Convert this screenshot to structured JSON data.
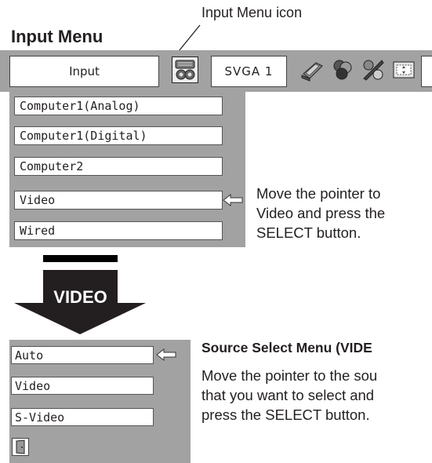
{
  "page_title": "Input Menu",
  "input_menu_icon_caption": "Input Menu icon",
  "menubar": {
    "input_label": "Input",
    "signal_label": "SVGA 1",
    "icons": [
      "input-menu-icon",
      "pc-adjust-icon",
      "color-adjust-icon",
      "image-adjust-icon",
      "screen-icon"
    ]
  },
  "input_menu": {
    "items": [
      "Computer1(Analog)",
      "Computer1(Digital)",
      "Computer2",
      "Video",
      "Wired"
    ],
    "selected": "Video"
  },
  "instruction_1": [
    "Move the pointer to",
    "Video and press the",
    "SELECT button."
  ],
  "arrow_label": "VIDEO",
  "source_menu": {
    "items": [
      "Auto",
      "Video",
      "S-Video"
    ],
    "selected": "Auto",
    "exit_icon": "exit-door-icon"
  },
  "source_select_title": "Source Select Menu (VIDE",
  "instruction_2": [
    "Move the pointer to the sou",
    "that you want to select and",
    "press the SELECT button."
  ]
}
